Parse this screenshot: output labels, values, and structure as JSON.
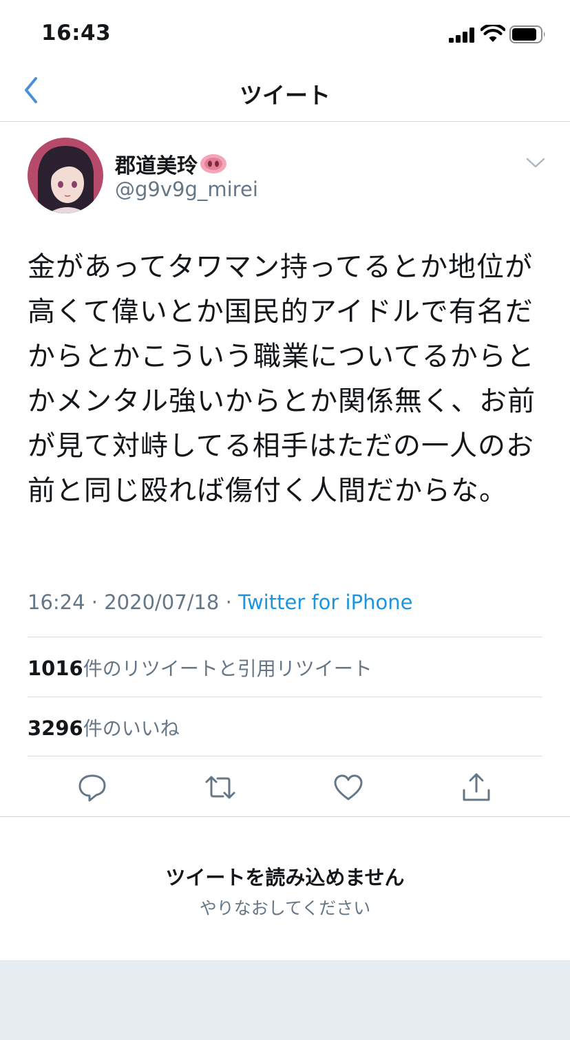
{
  "status_bar": {
    "time": "16:43",
    "icons": [
      "signal-icon",
      "wifi-icon",
      "battery-icon"
    ]
  },
  "nav": {
    "title": "ツイート",
    "back_icon": "chevron-left-icon"
  },
  "tweet": {
    "author_name": "郡道美玲",
    "author_emoji_icon": "pig-nose-icon",
    "author_handle": "@g9v9g_mirei",
    "text": "金があってタワマン持ってるとか地位が高くて偉いとか国民的アイドルで有名だからとかこういう職業についてるからとかメンタル強いからとか関係無く、お前が見て対峙してる相手はただの一人のお前と同じ殴れば傷付く人間だからな。",
    "timestamp": "16:24 · 2020/07/18 · ",
    "source": "Twitter for iPhone",
    "retweets": {
      "count": "1016",
      "label": "件のリツイートと引用リツイート"
    },
    "likes": {
      "count": "3296",
      "label": "件のいいね"
    },
    "actions": [
      "reply-icon",
      "retweet-icon",
      "like-icon",
      "share-icon"
    ]
  },
  "error": {
    "title": "ツイートを読み込めません",
    "retry": "やりなおしてください"
  },
  "colors": {
    "accent": "#1b95e0",
    "secondary_text": "#657786",
    "primary_text": "#14171a",
    "back_chevron": "#4a90d9",
    "bottom_gray": "#e6ecf0"
  }
}
